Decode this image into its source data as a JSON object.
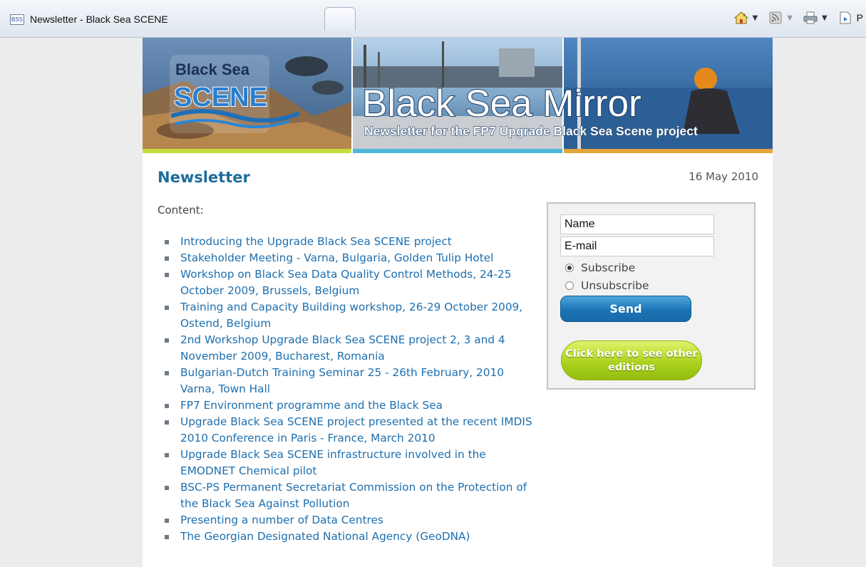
{
  "browser": {
    "tab_title": "Newsletter - Black Sea SCENE",
    "favicon_text": "BSS",
    "toolbar_icons": [
      "home-icon",
      "feeds-icon",
      "print-icon",
      "page-icon"
    ],
    "toolbar_letter": "P"
  },
  "banner": {
    "logo_line1": "Black Sea",
    "logo_line2": "SCENE",
    "headline": "Black Sea Mirror",
    "subhead": "Newsletter for the FP7 Upgrade Black Sea Scene project"
  },
  "header": {
    "title": "Newsletter",
    "date": "16 May 2010"
  },
  "content": {
    "label": "Content:",
    "items": [
      "Introducing the Upgrade Black Sea SCENE project",
      "Stakeholder Meeting - Varna, Bulgaria, Golden Tulip Hotel",
      "Workshop on Black Sea Data Quality Control Methods, 24-25 October 2009, Brussels, Belgium",
      "Training and Capacity Building workshop, 26-29 October 2009, Ostend, Belgium",
      "2nd Workshop Upgrade Black Sea SCENE project 2, 3 and 4 November 2009, Bucharest, Romania",
      "Bulgarian-Dutch Training Seminar 25 - 26th February, 2010 Varna, Town Hall",
      "FP7 Environment programme and the Black Sea",
      "Upgrade Black Sea SCENE project presented at the recent IMDIS 2010 Conference in Paris - France, March 2010",
      "Upgrade Black Sea SCENE infrastructure involved in the EMODNET Chemical pilot",
      "BSC-PS Permanent Secretariat Commission on the Protection of the Black Sea Against Pollution",
      "Presenting a number of Data Centres",
      "The Georgian Designated National Agency (GeoDNA)"
    ]
  },
  "subscribe": {
    "name_value": "Name",
    "email_value": "E-mail",
    "option_subscribe": "Subscribe",
    "option_unsubscribe": "Unsubscribe",
    "selected": "Subscribe",
    "send_label": "Send",
    "editions_label": "Click here to see other editions"
  },
  "colors": {
    "title_blue": "#1e6b9c",
    "link_blue": "#1e6fae",
    "send_blue": "#1b74b6",
    "editions_green": "#a8cf1a"
  }
}
